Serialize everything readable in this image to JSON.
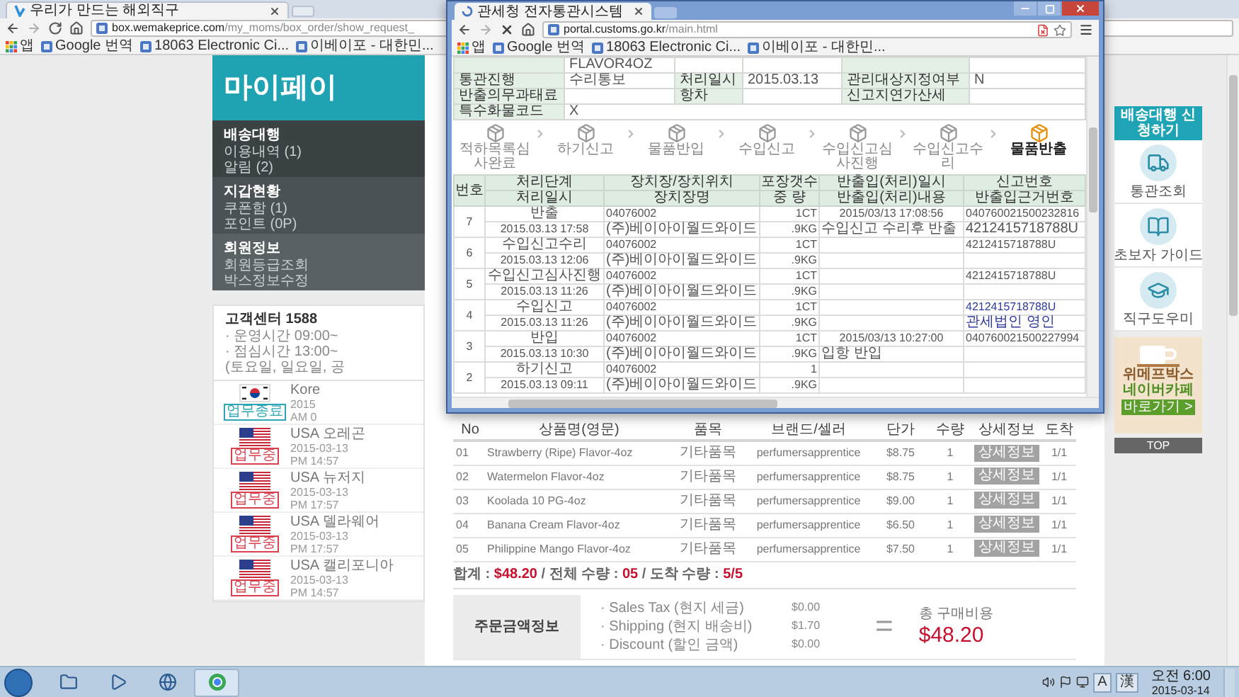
{
  "browser": {
    "tab": {
      "title": "우리가 만드는 해외직구"
    },
    "url": {
      "domain": "box.wemakeprice.com",
      "path": "/my_moms/box_order/show_request_"
    },
    "bookmarks": [
      {
        "kind": "apps",
        "label": "앱"
      },
      {
        "kind": "page",
        "label": "Google 번역"
      },
      {
        "kind": "page",
        "label": "18063 Electronic Ci..."
      },
      {
        "kind": "page",
        "label": "이베이포 - 대한민..."
      }
    ]
  },
  "sidebar": {
    "title": "마이페이",
    "sections": [
      {
        "heading": "배송대행",
        "links": [
          "이용내역 (1)",
          "알림 (2)"
        ]
      },
      {
        "heading": "지갑현황",
        "links": [
          "쿠폰함 (1)",
          "포인트 (0P)"
        ]
      },
      {
        "heading": "회원정보",
        "links": [
          "회원등급조회",
          "박스정보수정"
        ]
      }
    ],
    "support": {
      "title": "고객센터 1588",
      "lines": [
        "· 운영시간 09:00~",
        "· 점심시간 13:00~",
        "(토요일, 일요일, 공"
      ]
    },
    "centers": [
      {
        "kind": "kr",
        "name": "Kore",
        "date": "2015",
        "time": "AM 0",
        "status": "업무종료",
        "color": "#2aa6b6"
      },
      {
        "kind": "us",
        "name": "USA 오레곤",
        "date": "2015-03-13",
        "time": "PM 14:57",
        "status": "업무중",
        "color": "#d9414f"
      },
      {
        "kind": "us",
        "name": "USA 뉴저지",
        "date": "2015-03-13",
        "time": "PM 17:57",
        "status": "업무중",
        "color": "#d9414f"
      },
      {
        "kind": "us",
        "name": "USA 델라웨어",
        "date": "2015-03-13",
        "time": "PM 17:57",
        "status": "업무중",
        "color": "#d9414f"
      },
      {
        "kind": "us",
        "name": "USA 캘리포니아",
        "date": "2015-03-13",
        "time": "PM 14:57",
        "status": "업무중",
        "color": "#d9414f"
      }
    ]
  },
  "products": {
    "columns": [
      "No",
      "상품명(영문)",
      "품목",
      "브랜드/셀러",
      "단가",
      "수량",
      "상세정보",
      "도착"
    ],
    "rows": [
      {
        "no": "01",
        "name": "Strawberry (Ripe) Flavor-4oz",
        "category": "기타품목",
        "brand": "perfumersapprentice",
        "price": "$8.75",
        "qty": "1",
        "detail": "상세정보",
        "arrival": "1/1"
      },
      {
        "no": "02",
        "name": "Watermelon Flavor-4oz",
        "category": "기타품목",
        "brand": "perfumersapprentice",
        "price": "$8.75",
        "qty": "1",
        "detail": "상세정보",
        "arrival": "1/1"
      },
      {
        "no": "03",
        "name": "Koolada 10 PG-4oz",
        "category": "기타품목",
        "brand": "perfumersapprentice",
        "price": "$9.00",
        "qty": "1",
        "detail": "상세정보",
        "arrival": "1/1"
      },
      {
        "no": "04",
        "name": "Banana Cream Flavor-4oz",
        "category": "기타품목",
        "brand": "perfumersapprentice",
        "price": "$6.50",
        "qty": "1",
        "detail": "상세정보",
        "arrival": "1/1"
      },
      {
        "no": "05",
        "name": "Philippine Mango Flavor-4oz",
        "category": "기타품목",
        "brand": "perfumersapprentice",
        "price": "$7.50",
        "qty": "1",
        "detail": "상세정보",
        "arrival": "1/1"
      }
    ]
  },
  "summary": [
    {
      "label": "합계 : ",
      "value": "$48.20"
    },
    {
      "label": " / 전체 수량 : ",
      "value": "05"
    },
    {
      "label": " / 도착 수량 : ",
      "value": "5/5"
    }
  ],
  "payment": {
    "title": "주문금액정보",
    "items": [
      {
        "label": "· Sales Tax (현지 세금)",
        "amount": "$0.00"
      },
      {
        "label": "· Shipping (현지 배송비)",
        "amount": "$1.70"
      },
      {
        "label": "· Discount (할인 금액)",
        "amount": "$0.00"
      }
    ],
    "operator": "=",
    "total_label": "총 구매비용",
    "total": "$48.20"
  },
  "quick_menu": {
    "apply": "배송대행 신청하기",
    "items": [
      {
        "kind": "truck",
        "label": "통관조회"
      },
      {
        "kind": "book",
        "label": "초보자 가이드"
      },
      {
        "kind": "cap",
        "label": "직구도우미"
      }
    ],
    "banner": {
      "lines": [
        "위메프박스",
        "네이버카페"
      ],
      "button": "바로가기 >"
    },
    "top": "TOP"
  },
  "popup": {
    "tab": {
      "title": "관세청 전자통관시스템"
    },
    "url": {
      "domain": "portal.customs.go.kr",
      "path": "/main.html"
    },
    "bookmarks": [
      {
        "kind": "apps",
        "label": "앱"
      },
      {
        "kind": "page",
        "label": "Google 번역"
      },
      {
        "kind": "page",
        "label": "18063 Electronic Ci..."
      },
      {
        "kind": "page",
        "label": "이베이포 - 대한민..."
      }
    ],
    "info": [
      {
        "cells": [
          {
            "kind": "label"
          },
          {
            "kind": "value",
            "text": "FLAVOR4OZ"
          },
          {
            "kind": "value"
          },
          {
            "kind": "value"
          },
          {
            "kind": "label"
          },
          {
            "kind": "value"
          }
        ]
      },
      {
        "cells": [
          {
            "kind": "label",
            "text": "통관진행"
          },
          {
            "kind": "value",
            "text": "수리통보"
          },
          {
            "kind": "label",
            "text": "처리일시"
          },
          {
            "kind": "value",
            "text": "2015.03.13"
          },
          {
            "kind": "label",
            "text": "관리대상지정여부"
          },
          {
            "kind": "value",
            "text": "N"
          }
        ]
      },
      {
        "cells": [
          {
            "kind": "label",
            "text": "반출의무과태료"
          },
          {
            "kind": "value"
          },
          {
            "kind": "label",
            "text": "항차"
          },
          {
            "kind": "value"
          },
          {
            "kind": "label",
            "text": "신고지연가산세"
          },
          {
            "kind": "value"
          }
        ]
      },
      {
        "cells": [
          {
            "kind": "label",
            "text": "특수화물코드"
          },
          {
            "kind": "value",
            "text": "X"
          }
        ]
      }
    ],
    "steps": [
      {
        "label": "적하목록심사완료",
        "selected": false
      },
      {
        "label": "하기신고",
        "selected": false
      },
      {
        "label": "물품반입",
        "selected": false
      },
      {
        "label": "수입신고",
        "selected": false
      },
      {
        "label": "수입신고심사진행",
        "selected": false
      },
      {
        "label": "수입신고수리",
        "selected": false
      },
      {
        "label": "물품반출",
        "selected": true
      }
    ],
    "table": {
      "number_header": "번호",
      "top_headers": [
        "처리단계",
        "장치장/장치위치",
        "포장갯수",
        "반출입(처리)일시",
        "신고번호"
      ],
      "bottom_headers": [
        "처리일시",
        "장치장명",
        "중 량",
        "반출입(처리)내용",
        "반출입근거번호"
      ],
      "records": [
        {
          "no": "7",
          "stage": "반출",
          "location": "04076002",
          "count": "1CT",
          "datetime": "2015/03/13 17:08:56",
          "report_no": {
            "text": "040760021500232816",
            "link": false
          },
          "time": "2015.03.13 17:58",
          "location_name": "(주)베이아이월드와이드",
          "weight": ".9KG",
          "content": "수입신고 수리후 반출",
          "basis_no": {
            "text": "4212415718788U",
            "link": false
          }
        },
        {
          "no": "6",
          "stage": "수입신고수리",
          "location": "04076002",
          "count": "1CT",
          "report_no": {
            "text": "4212415718788U",
            "link": false
          },
          "time": "2015.03.13 12:06",
          "location_name": "(주)베이아이월드와이드",
          "weight": ".9KG"
        },
        {
          "no": "5",
          "stage": "수입신고심사진행",
          "location": "04076002",
          "count": "1CT",
          "report_no": {
            "text": "4212415718788U",
            "link": false
          },
          "time": "2015.03.13 11:26",
          "location_name": "(주)베이아이월드와이드",
          "weight": ".9KG"
        },
        {
          "no": "4",
          "stage": "수입신고",
          "location": "04076002",
          "count": "1CT",
          "report_no": {
            "text": "4212415718788U",
            "link": true
          },
          "time": "2015.03.13 11:26",
          "location_name": "(주)베이아이월드와이드",
          "weight": ".9KG",
          "basis_no": {
            "text": "관세법인 영인",
            "link": true
          }
        },
        {
          "no": "3",
          "stage": "반입",
          "location": "04076002",
          "count": "1CT",
          "datetime": "2015/03/13 10:27:00",
          "report_no": {
            "text": "040760021500227994",
            "link": false
          },
          "time": "2015.03.13 10:30",
          "location_name": "(주)베이아이월드와이드",
          "weight": ".9KG",
          "content": "입항 반입"
        },
        {
          "no": "2",
          "stage": "하기신고",
          "location": "04076002",
          "count": "1",
          "time": "2015.03.13 09:11",
          "location_name": "(주)베이아이월드와이드",
          "weight": ".9KG"
        }
      ]
    }
  },
  "taskbar": {
    "ime": [
      "A",
      "漢"
    ],
    "time": "오전 6:00",
    "date": "2015-03-14"
  }
}
